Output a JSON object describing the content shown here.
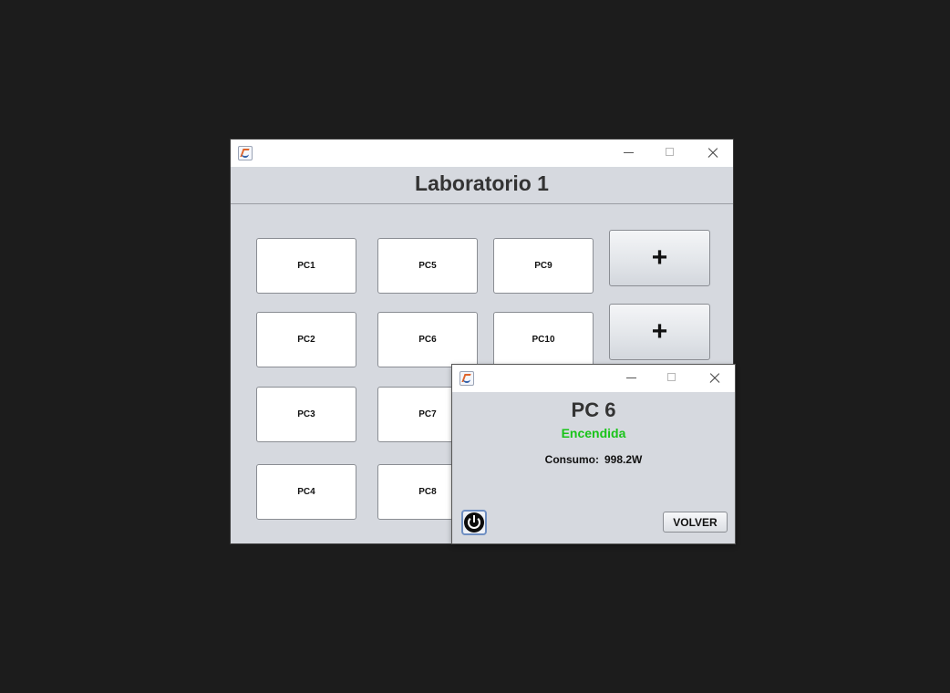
{
  "lab_window": {
    "title": "Laboratorio 1",
    "window_controls": [
      "minimize-icon",
      "maximize-icon",
      "close-icon"
    ],
    "pc_buttons": [
      "PC1",
      "PC2",
      "PC3",
      "PC4",
      "PC5",
      "PC6",
      "PC7",
      "PC8",
      "PC9",
      "PC10"
    ],
    "add_buttons": [
      "+",
      "+"
    ]
  },
  "pc_dialog": {
    "name": "PC 6",
    "status": "Encendida",
    "status_color": "#19c419",
    "consumo_label": "Consumo:",
    "consumo_value": "998.2W",
    "power_icon": "power-icon",
    "volver_label": "VOLVER"
  }
}
